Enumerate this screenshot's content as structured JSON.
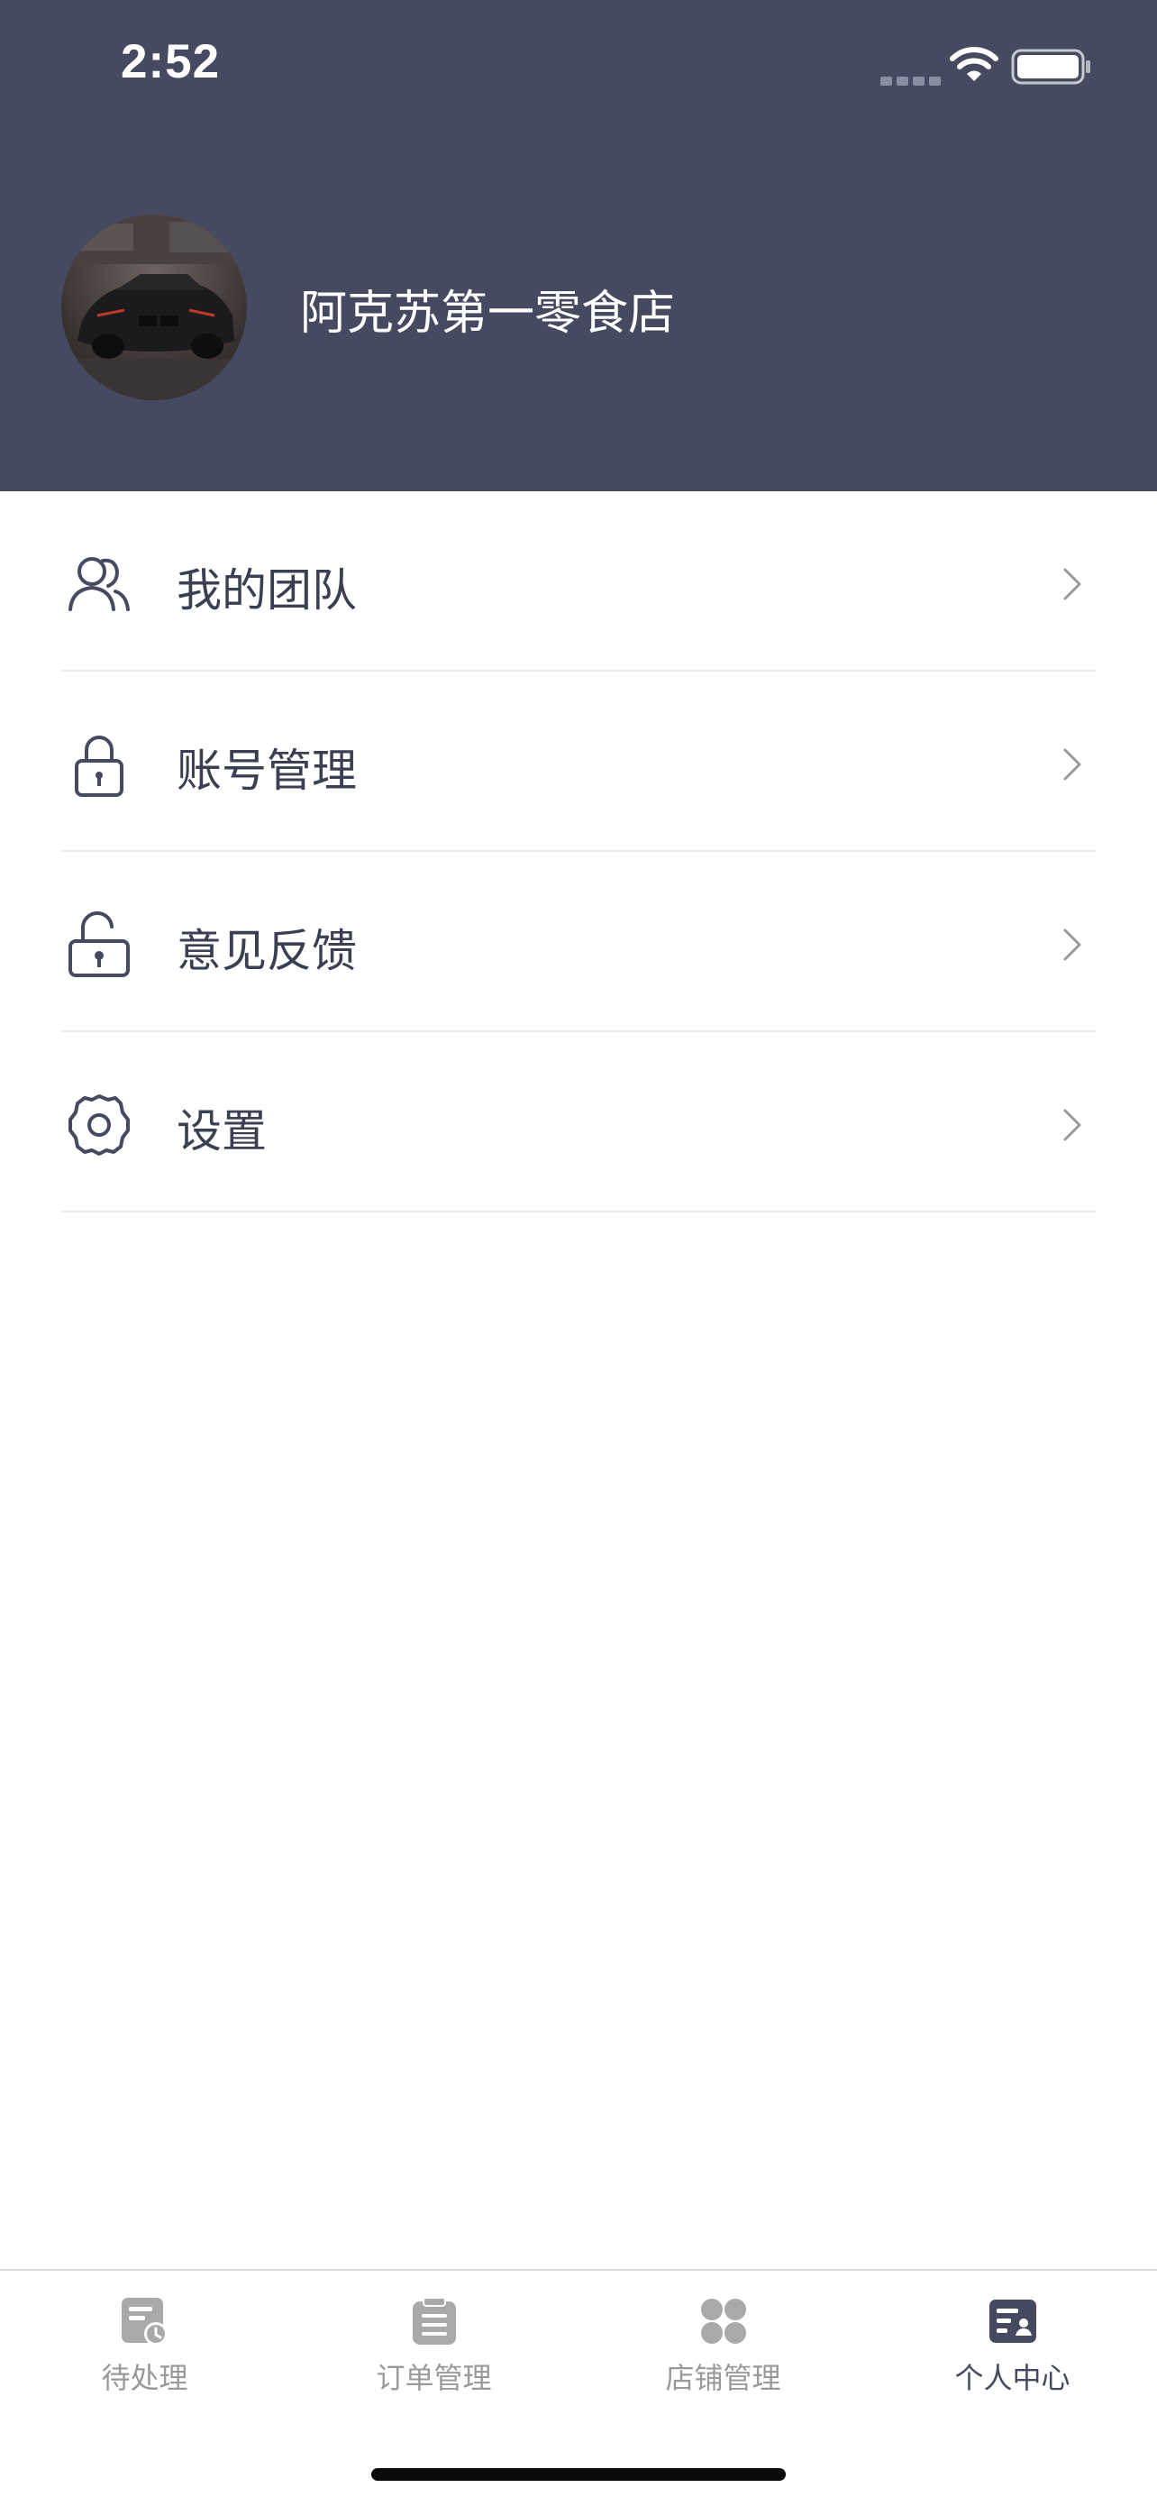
{
  "status_bar": {
    "time": "2:52"
  },
  "profile": {
    "store_name": "阿克苏第一零食店"
  },
  "menu": {
    "items": [
      {
        "label": "我的团队",
        "icon": "team-icon"
      },
      {
        "label": "账号管理",
        "icon": "lock-icon"
      },
      {
        "label": "意见反馈",
        "icon": "unlock-icon"
      },
      {
        "label": "设置",
        "icon": "gear-icon"
      }
    ]
  },
  "tab_bar": {
    "items": [
      {
        "label": "待处理",
        "icon": "pending-icon",
        "active": false
      },
      {
        "label": "订单管理",
        "icon": "clipboard-icon",
        "active": false
      },
      {
        "label": "店铺管理",
        "icon": "grid-icon",
        "active": false
      },
      {
        "label": "个人中心",
        "icon": "profile-card-icon",
        "active": true
      }
    ]
  },
  "colors": {
    "header_bg": "#454a61",
    "accent": "#454a61",
    "text_primary": "#3b3f52",
    "tab_inactive": "#9a9a9a"
  }
}
